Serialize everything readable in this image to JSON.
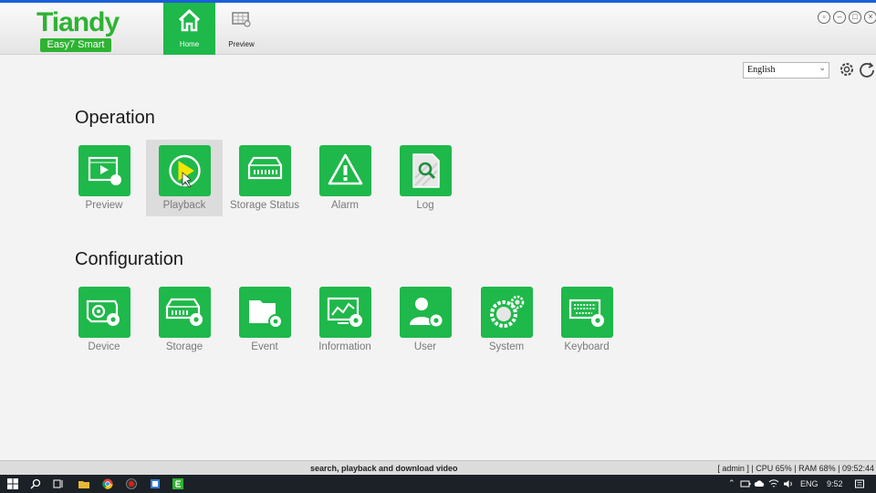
{
  "app": {
    "brand": "Tiandy",
    "product": "Easy7 Smart"
  },
  "nav": {
    "home_label": "Home",
    "preview_label": "Preview"
  },
  "toolbar": {
    "language": "English"
  },
  "operation": {
    "title": "Operation",
    "items": [
      {
        "label": "Preview",
        "icon": "preview-icon"
      },
      {
        "label": "Playback",
        "icon": "playback-icon"
      },
      {
        "label": "Storage Status",
        "icon": "storage-status-icon"
      },
      {
        "label": "Alarm",
        "icon": "alarm-icon"
      },
      {
        "label": "Log",
        "icon": "log-icon"
      }
    ]
  },
  "configuration": {
    "title": "Configuration",
    "items": [
      {
        "label": "Device",
        "icon": "device-icon"
      },
      {
        "label": "Storage",
        "icon": "storage-icon"
      },
      {
        "label": "Event",
        "icon": "event-icon"
      },
      {
        "label": "Information",
        "icon": "information-icon"
      },
      {
        "label": "User",
        "icon": "user-icon"
      },
      {
        "label": "System",
        "icon": "system-icon"
      },
      {
        "label": "Keyboard",
        "icon": "keyboard-icon"
      }
    ]
  },
  "status": {
    "message": "search, playback and download video",
    "system": "[ admin ] | CPU  65% | RAM  68% | 09:52:44"
  },
  "taskbar": {
    "language": "ENG",
    "time": "9:52"
  },
  "colors": {
    "accent": "#1fb84a",
    "brand": "#2fb233",
    "titlebar": "#1a5fd6"
  }
}
